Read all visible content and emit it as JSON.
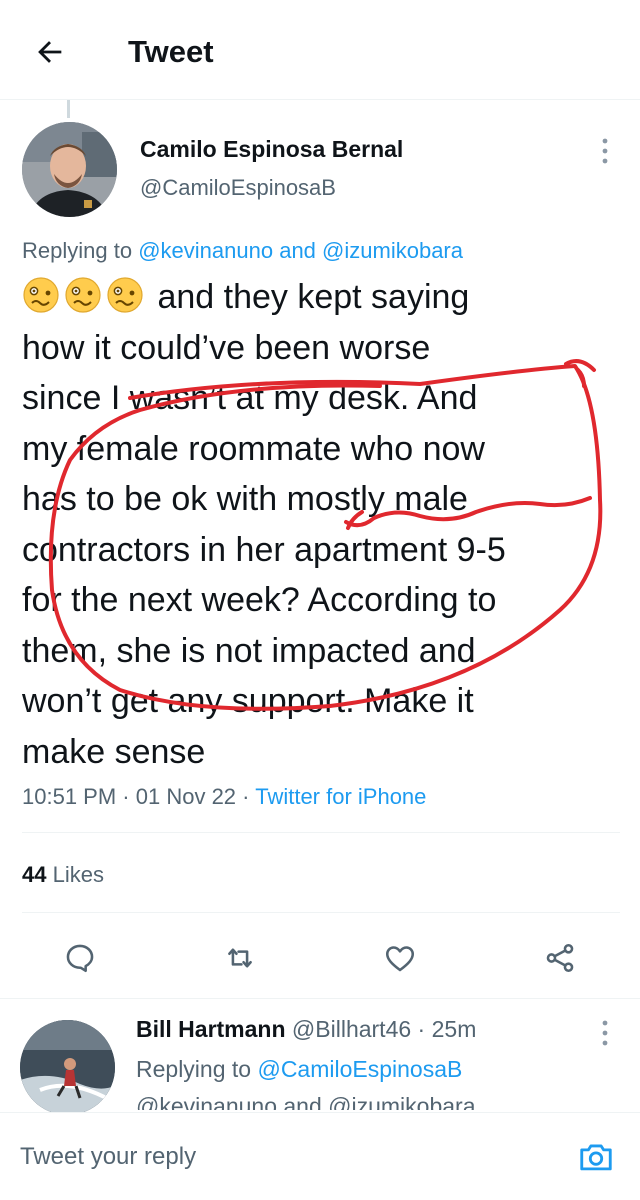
{
  "header": {
    "title": "Tweet"
  },
  "tweet": {
    "author_name": "Camilo Espinosa Bernal",
    "author_handle": "@CamiloEspinosaB",
    "replying_prefix": "Replying to",
    "replying_user_1": "@kevinanuno",
    "replying_and": "and",
    "replying_user_2": "@izumikobara",
    "emoji_icon": "woozy-face-icon",
    "text_lines": [
      "and they kept saying",
      "how it could’ve been worse",
      "since I wasn’t at my desk. And",
      "my female roommate who now",
      "has to be ok with mostly male",
      "contractors in her apartment 9-5",
      "for the next week? According to",
      "them, she is not impacted and",
      "won’t get any support. Make it",
      "make sense"
    ],
    "time": "10:51 PM",
    "date": "01 Nov 22",
    "source": "Twitter for iPhone",
    "meta_separator": "·",
    "likes_count": "44",
    "likes_label": "Likes",
    "annotation_color": "#e0282e"
  },
  "actions": [
    {
      "name": "reply-icon"
    },
    {
      "name": "retweet-icon"
    },
    {
      "name": "like-icon"
    },
    {
      "name": "share-icon"
    }
  ],
  "reply": {
    "name": "Bill Hartmann",
    "handle": "@Billhart46",
    "separator": "·",
    "time": "25m",
    "replying_prefix": "Replying to",
    "replying_user_1": "@CamiloEspinosaB",
    "replying_line2": "@kevinanuno and @izumikobara"
  },
  "composer": {
    "placeholder": "Tweet your reply"
  },
  "colors": {
    "link": "#1d9bf0",
    "text": "#0f1419",
    "secondary": "#536471"
  }
}
